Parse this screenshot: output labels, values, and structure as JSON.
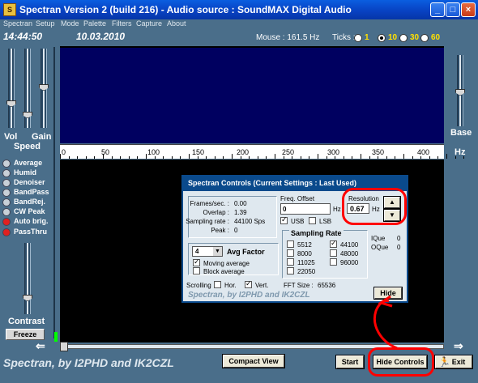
{
  "window": {
    "title": "Spectran Version 2 (build 216) - Audio source  :  SoundMAX Digital Audio",
    "icon_glyph": "S",
    "minimize": "_",
    "maximize": "□",
    "close": "×"
  },
  "menu": [
    "Spectran",
    "Setup",
    "Mode",
    "Palette",
    "Filters",
    "Capture",
    "About"
  ],
  "status": {
    "time": "14:44:50",
    "date": "10.03.2010",
    "mouse": "Mouse :   161.5 Hz",
    "ticks_label": "Ticks :",
    "tick_options": [
      "1",
      "10",
      "30",
      "60"
    ],
    "tick_selected": "10"
  },
  "axis": {
    "labels": [
      "0",
      "50",
      "100",
      "150",
      "200",
      "250",
      "300",
      "350",
      "400"
    ]
  },
  "left_panel": {
    "vol_label": "Vol",
    "gain_label": "Gain",
    "speed_label": "Speed",
    "options": [
      {
        "label": "Average",
        "active": false
      },
      {
        "label": "Humid",
        "active": false
      },
      {
        "label": "Denoiser",
        "active": false
      },
      {
        "label": "BandPass",
        "active": false
      },
      {
        "label": "BandRej.",
        "active": false
      },
      {
        "label": "CW Peak",
        "active": false
      },
      {
        "label": "Auto brig.",
        "active": true
      },
      {
        "label": "PassThru",
        "active": true
      }
    ],
    "contrast_label": "Contrast",
    "freeze_label": "Freeze"
  },
  "right_panel": {
    "base_label": "Base",
    "hz_label": "Hz"
  },
  "dialog": {
    "title": "Spectran Controls  (Current Settings : Last Used)",
    "frames_sec_label": "Frames/sec. :",
    "frames_sec_value": "0.00",
    "overlap_label": "Overlap :",
    "overlap_value": "1.39",
    "sampling_rate_label": "Sampling rate :",
    "sampling_rate_value": "44100 Sps",
    "peak_label": "Peak :",
    "peak_value": "0",
    "freq_offset_label": "Freq. Offset",
    "freq_offset_value": "0",
    "freq_offset_unit": "Hz",
    "usb_label": "USB",
    "lsb_label": "LSB",
    "resolution_label": "Resolution",
    "resolution_value": "0.67",
    "resolution_unit": "Hz",
    "sampling_rate_title": "Sampling Rate",
    "rates_col1": [
      "5512",
      "8000",
      "11025",
      "22050"
    ],
    "rates_col2": [
      "44100",
      "48000",
      "96000"
    ],
    "rate_selected": "44100",
    "avg_factor_value": "4",
    "avg_factor_label": "Avg Factor",
    "moving_avg_label": "Moving average",
    "block_avg_label": "Block average",
    "scrolling_label": "Scrolling",
    "hor_label": "Hor.",
    "vert_label": "Vert.",
    "fft_size_label": "FFT Size :",
    "fft_size_value": "65536",
    "ique_label": "IQue",
    "ique_value": "0",
    "oque_label": "OQue",
    "oque_value": "0",
    "hide_label": "Hide",
    "watermark": "Spectran, by I2PHD and IK2CZL"
  },
  "footer": {
    "brand": "Spectran, by I2PHD and IK2CZL",
    "compact_view": "Compact View",
    "start": "Start",
    "hide_controls": "Hide Controls",
    "exit": "Exit"
  },
  "colors": {
    "background": "#4a6e8a",
    "spectrum_bg": "#000060",
    "annotation_red": "#ff0000",
    "dialog_title_bg": "#0a4a8c"
  }
}
